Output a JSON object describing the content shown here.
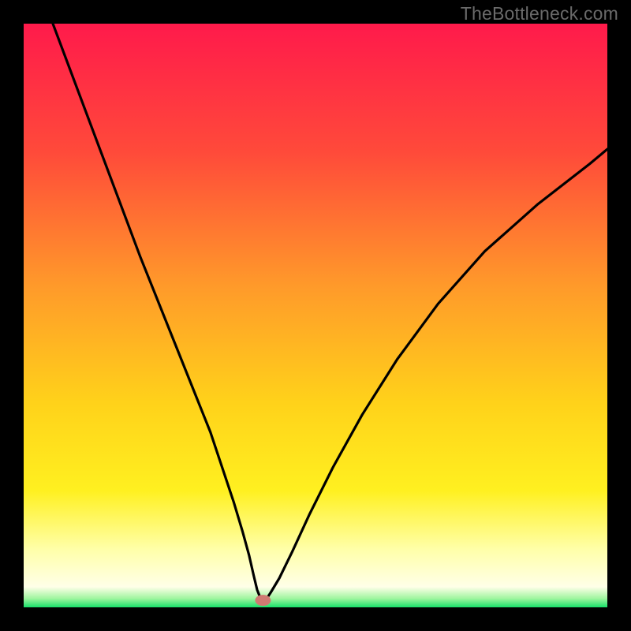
{
  "watermark": "TheBottleneck.com",
  "chart_data": {
    "type": "line",
    "title": "",
    "xlabel": "",
    "ylabel": "",
    "xlim": [
      0,
      100
    ],
    "ylim": [
      0,
      100
    ],
    "gradient_stops": [
      {
        "offset": 0.0,
        "color": "#ff1a4b"
      },
      {
        "offset": 0.22,
        "color": "#ff4a3a"
      },
      {
        "offset": 0.45,
        "color": "#ff9a2a"
      },
      {
        "offset": 0.65,
        "color": "#ffd21a"
      },
      {
        "offset": 0.8,
        "color": "#fff020"
      },
      {
        "offset": 0.9,
        "color": "#ffffa8"
      },
      {
        "offset": 0.965,
        "color": "#ffffe8"
      },
      {
        "offset": 0.985,
        "color": "#9ef59e"
      },
      {
        "offset": 1.0,
        "color": "#17e06a"
      }
    ],
    "series": [
      {
        "name": "bottleneck-curve",
        "x": [
          5,
          8,
          11,
          14,
          17,
          20,
          23,
          26,
          29,
          32,
          34,
          36,
          37.5,
          38.6,
          39.4,
          40.0,
          40.6,
          41.3,
          42.3,
          43.8,
          46.0,
          49.0,
          53.0,
          58.0,
          64.0,
          71.0,
          79.0,
          88.0,
          97.0,
          100.0
        ],
        "y": [
          100,
          92,
          84,
          76,
          68,
          60,
          52.5,
          45,
          37.5,
          30,
          24,
          18,
          13,
          9,
          5.5,
          3.0,
          1.5,
          1.0,
          2.5,
          5.0,
          9.5,
          16.0,
          24.0,
          33.0,
          42.5,
          52.0,
          61.0,
          69.0,
          76.0,
          78.5
        ]
      }
    ],
    "minimum_marker": {
      "x": 41.0,
      "y": 1.2,
      "color": "#d07a72"
    }
  }
}
